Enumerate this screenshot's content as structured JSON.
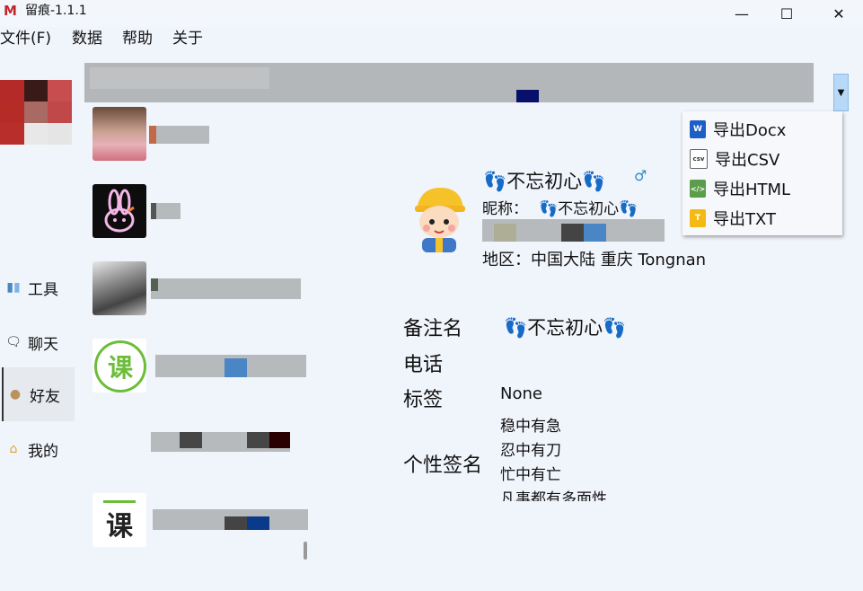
{
  "window": {
    "title": "留痕-1.1.1",
    "logo_letter": "M",
    "controls": {
      "minimize": "—",
      "maximize": "☐",
      "close": "✕"
    }
  },
  "menu": {
    "items": [
      "文件(F)",
      "数据",
      "帮助",
      "关于"
    ]
  },
  "nav": {
    "tools": "工具",
    "chat": "聊天",
    "friends": "好友",
    "mine": "我的"
  },
  "export_menu": {
    "items": [
      {
        "label": "导出Docx",
        "icon": "word-icon",
        "color": "#1e5fc6"
      },
      {
        "label": "导出CSV",
        "icon": "csv-icon",
        "color": "#ffffff"
      },
      {
        "label": "导出HTML",
        "icon": "html-icon",
        "color": "#5a9d4a"
      },
      {
        "label": "导出TXT",
        "icon": "txt-icon",
        "color": "#f5b914"
      }
    ]
  },
  "friends_list": {
    "item4_icon_text": "课",
    "item6_icon_text": "课"
  },
  "profile": {
    "display_name": "👣不忘初心👣",
    "gender_symbol": "♂",
    "nickname_label": "昵称：",
    "nickname_value": "👣不忘初心👣",
    "region": "地区：中国大陆 重庆 Tongnan",
    "fields": {
      "remark_label": "备注名",
      "remark_value": "👣不忘初心👣",
      "phone_label": "电话",
      "phone_value": "",
      "tag_label": "标签",
      "tag_value": "None",
      "signature_label": "个性签名",
      "signature_lines": [
        "稳中有急",
        "忍中有刀",
        "忙中有亡",
        "凡事都有多面性"
      ]
    }
  },
  "colors": {
    "accent_blue": "#4a86c5",
    "page_bg": "#f0f4fb",
    "redact_gray": "#b7babc"
  }
}
